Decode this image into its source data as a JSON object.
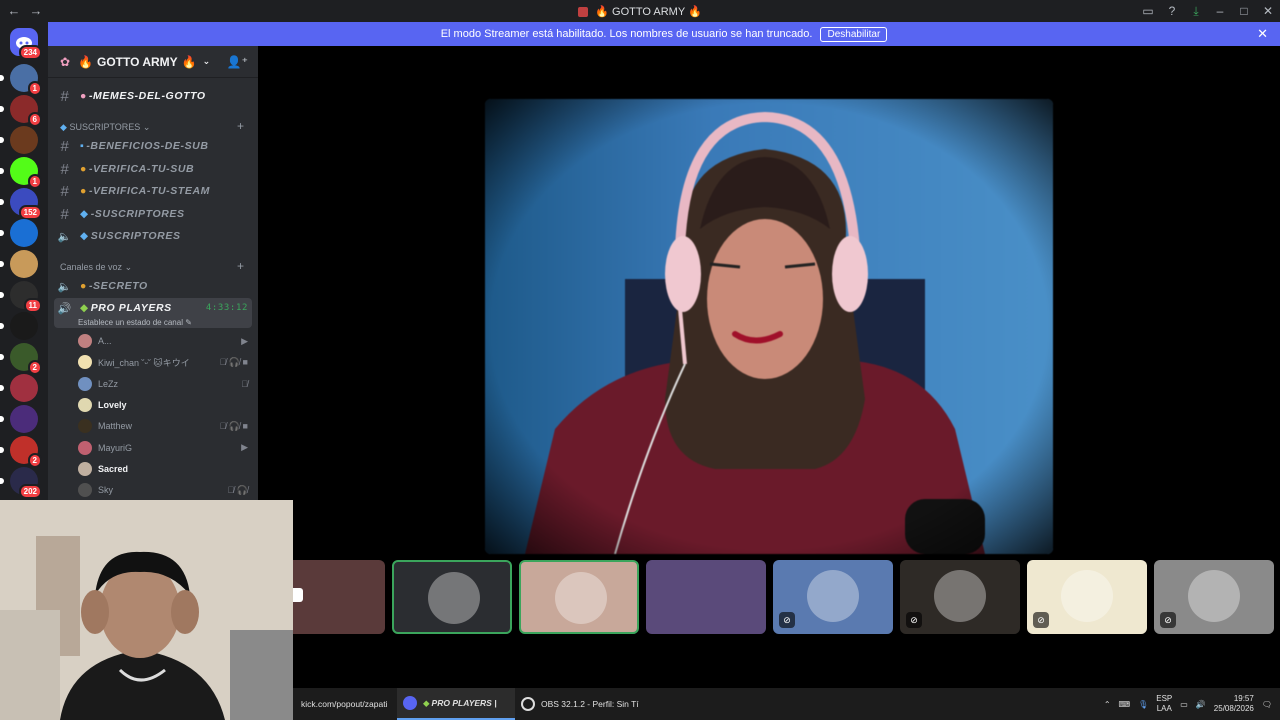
{
  "window": {
    "title": "GOTTO ARMY",
    "back_icon": "arrow-left-icon",
    "forward_icon": "arrow-right-icon"
  },
  "banner": {
    "text": "El modo Streamer está habilitado. Los nombres de usuario se han truncado.",
    "button": "Deshabilitar"
  },
  "guilds": {
    "home_badge": "234",
    "items": [
      {
        "badge": "1",
        "color": "#4a6fa5"
      },
      {
        "badge": "6",
        "color": "#8b2a2a"
      },
      {
        "badge": "",
        "color": "#6b3a1e"
      },
      {
        "badge": "1",
        "color": "#53fc18"
      },
      {
        "badge": "152",
        "color": "#3b4bbf"
      },
      {
        "badge": "",
        "color": "#1a6fd4"
      },
      {
        "badge": "",
        "color": "#c89a5a"
      },
      {
        "badge": "11",
        "color": "#2d2d2d"
      },
      {
        "badge": "",
        "color": "#1a1a1a"
      },
      {
        "badge": "2",
        "color": "#3a5a2a"
      },
      {
        "badge": "",
        "color": "#a03040"
      },
      {
        "badge": "",
        "color": "#4b2c7a"
      },
      {
        "badge": "2",
        "color": "#c0302a"
      },
      {
        "badge": "202",
        "color": "#2a2a4a"
      }
    ]
  },
  "server": {
    "name": "GOTTO ARMY"
  },
  "channels": {
    "top": "-MEMES-DEL-GOTTO",
    "category_subs": "SUSCRIPTORES",
    "subs": [
      "-BENEFICIOS-DE-SUB",
      "-VERIFICA-TU-SUB",
      "-VERIFICA-TU-STEAM",
      "-SUSCRIPTORES",
      "SUSCRIPTORES"
    ],
    "category_voice": "Canales de voz",
    "voice": [
      {
        "name": "-SECRETO"
      }
    ],
    "active_voice": {
      "name": "PRO PLAYERS",
      "timer": "4:33:12",
      "status": "Establece un estado de canal"
    },
    "users": [
      {
        "name": "A...",
        "color": "#c08080",
        "bright": false,
        "icons": "cam"
      },
      {
        "name": "Kiwi_chan ˘ᵕ˘ 🐱キウイ",
        "color": "#f0e0b0",
        "bright": false,
        "icons": "mute-deaf-live"
      },
      {
        "name": "LeZz",
        "color": "#7090c0",
        "bright": false,
        "icons": "mute"
      },
      {
        "name": "Lovely",
        "color": "#e0d8b0",
        "bright": true,
        "icons": ""
      },
      {
        "name": "Matthew",
        "color": "#3a3020",
        "bright": false,
        "icons": "mute-deaf-live"
      },
      {
        "name": "MayuriG",
        "color": "#c06070",
        "bright": false,
        "icons": "cam"
      },
      {
        "name": "Sacred",
        "color": "#c0b0a0",
        "bright": true,
        "icons": ""
      },
      {
        "name": "Sky",
        "color": "#505050",
        "bright": false,
        "icons": "mute-deaf"
      }
    ]
  },
  "tiles": [
    {
      "type": "camera",
      "bg": "#5a3a3a",
      "speaking": false
    },
    {
      "type": "avatar",
      "bg": "#2b2d31",
      "speaking": true
    },
    {
      "type": "avatar",
      "bg": "#c8a89a",
      "speaking": true
    },
    {
      "type": "stream",
      "bg": "#5a4a7a",
      "speaking": false
    },
    {
      "type": "avatar",
      "bg": "#5a7ab0",
      "speaking": false
    },
    {
      "type": "avatar",
      "bg": "#2e2a26",
      "speaking": false
    },
    {
      "type": "avatar",
      "bg": "#efe8d0",
      "speaking": false
    },
    {
      "type": "avatar",
      "bg": "#8a8a8a",
      "speaking": false
    }
  ],
  "taskbar": {
    "task1": "kick.com/popout/zapati",
    "task2": "PRO PLAYERS |",
    "task3": "OBS 32.1.2 - Perfil: Sin Tí",
    "lang1": "ESP",
    "lang2": "LAA",
    "time": "19:57",
    "date": "25/08/2026"
  }
}
